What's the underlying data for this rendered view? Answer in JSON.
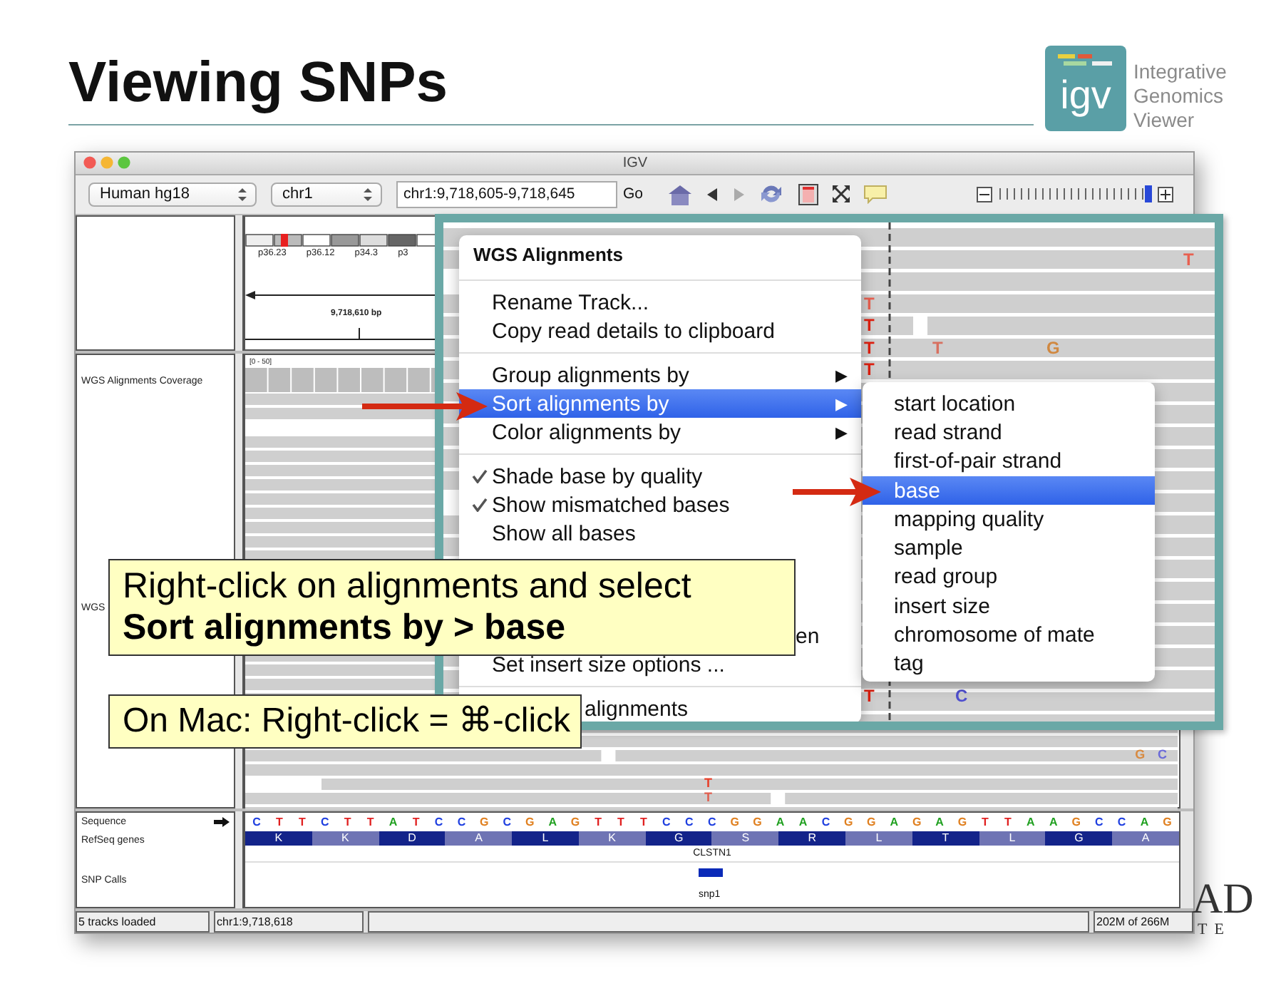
{
  "slide": {
    "title": "Viewing SNPs",
    "logo": {
      "mark": "igv",
      "lines": [
        "Integrative",
        "Genomics",
        "Viewer"
      ]
    },
    "background_logo": [
      "AD",
      "TE"
    ]
  },
  "window": {
    "title": "IGV"
  },
  "toolbar": {
    "genome": "Human hg18",
    "chromosome": "chr1",
    "locus": "chr1:9,718,605-9,718,645",
    "go": "Go",
    "back_disabled": false,
    "forward_disabled": true,
    "zoom": {
      "level": 1
    }
  },
  "ideogram": {
    "bands": [
      "p36.23",
      "p36.12",
      "p34.3",
      "p3"
    ]
  },
  "ruler": {
    "label": "9,718,610 bp"
  },
  "coverage": {
    "name": "WGS Alignments Coverage",
    "range": "[0 - 50]"
  },
  "alignments": {
    "name": "WGS",
    "mismatches": [
      {
        "base": "G",
        "color": "#d88a40"
      },
      {
        "base": "C",
        "color": "#6a6ad8"
      },
      {
        "base": "T",
        "color": "#e8402a"
      },
      {
        "base": "T",
        "color": "#e06050"
      }
    ]
  },
  "sequence": {
    "name": "Sequence",
    "bases": [
      {
        "base": "C",
        "color": "#2040e0"
      },
      {
        "base": "T",
        "color": "#e02020"
      },
      {
        "base": "T",
        "color": "#e02020"
      },
      {
        "base": "C",
        "color": "#2040e0"
      },
      {
        "base": "T",
        "color": "#e02020"
      },
      {
        "base": "T",
        "color": "#e02020"
      },
      {
        "base": "A",
        "color": "#20a020"
      },
      {
        "base": "T",
        "color": "#e02020"
      },
      {
        "base": "C",
        "color": "#2040e0"
      },
      {
        "base": "C",
        "color": "#2040e0"
      },
      {
        "base": "G",
        "color": "#e08020"
      },
      {
        "base": "C",
        "color": "#2040e0"
      },
      {
        "base": "G",
        "color": "#e08020"
      },
      {
        "base": "A",
        "color": "#20a020"
      },
      {
        "base": "G",
        "color": "#e08020"
      },
      {
        "base": "T",
        "color": "#e02020"
      },
      {
        "base": "T",
        "color": "#e02020"
      },
      {
        "base": "T",
        "color": "#e02020"
      },
      {
        "base": "C",
        "color": "#2040e0"
      },
      {
        "base": "C",
        "color": "#2040e0"
      },
      {
        "base": "C",
        "color": "#2040e0"
      },
      {
        "base": "G",
        "color": "#e08020"
      },
      {
        "base": "G",
        "color": "#e08020"
      },
      {
        "base": "A",
        "color": "#20a020"
      },
      {
        "base": "A",
        "color": "#20a020"
      },
      {
        "base": "C",
        "color": "#2040e0"
      },
      {
        "base": "G",
        "color": "#e08020"
      },
      {
        "base": "G",
        "color": "#e08020"
      },
      {
        "base": "A",
        "color": "#20a020"
      },
      {
        "base": "G",
        "color": "#e08020"
      },
      {
        "base": "A",
        "color": "#20a020"
      },
      {
        "base": "G",
        "color": "#e08020"
      },
      {
        "base": "T",
        "color": "#e02020"
      },
      {
        "base": "T",
        "color": "#e02020"
      },
      {
        "base": "A",
        "color": "#20a020"
      },
      {
        "base": "A",
        "color": "#20a020"
      },
      {
        "base": "G",
        "color": "#e08020"
      },
      {
        "base": "C",
        "color": "#2040e0"
      },
      {
        "base": "C",
        "color": "#2040e0"
      },
      {
        "base": "A",
        "color": "#20a020"
      },
      {
        "base": "G",
        "color": "#e08020"
      }
    ]
  },
  "genes": {
    "name": "RefSeq genes",
    "amino_acids": [
      "K",
      "K",
      "D",
      "A",
      "L",
      "K",
      "G",
      "S",
      "R",
      "L",
      "T",
      "L",
      "G",
      "A"
    ],
    "gene": "CLSTN1"
  },
  "snps": {
    "name": "SNP Calls",
    "label": "snp1"
  },
  "status_bar": {
    "left": [
      "5 tracks loaded",
      "chr1:9,718,618"
    ],
    "right": "202M of 266M"
  },
  "inset": {
    "menu": {
      "title": "WGS Alignments",
      "items": [
        {
          "kind": "separator"
        },
        {
          "kind": "item",
          "label": "Rename Track...",
          "selected": false
        },
        {
          "kind": "item",
          "label": "Copy read details to clipboard",
          "selected": false
        },
        {
          "kind": "separator"
        },
        {
          "kind": "submenu",
          "label": "Group alignments by",
          "arrow": "▶",
          "selected": false
        },
        {
          "kind": "submenu",
          "label": "Sort alignments by",
          "arrow": "▶",
          "selected": true
        },
        {
          "kind": "submenu",
          "label": "Color alignments by",
          "arrow": "▶",
          "selected": false
        },
        {
          "kind": "separator"
        },
        {
          "kind": "check",
          "label": "Shade base by quality",
          "checked": true,
          "selected": false
        },
        {
          "kind": "check",
          "label": "Show mismatched bases",
          "checked": true,
          "selected": false
        },
        {
          "kind": "check",
          "label": "Show all bases",
          "checked": false,
          "selected": false
        }
      ],
      "lower_items": [
        {
          "kind": "fragment",
          "label": "en"
        },
        {
          "kind": "item",
          "label": "Set insert size options ...",
          "selected": false
        },
        {
          "kind": "separator"
        },
        {
          "kind": "fragment",
          "label": "alignments"
        }
      ]
    },
    "submenu": [
      {
        "label": "start location",
        "selected": false
      },
      {
        "label": "read strand",
        "selected": false
      },
      {
        "label": "first-of-pair strand",
        "selected": false
      },
      {
        "label": "base",
        "selected": true
      },
      {
        "label": "mapping quality",
        "selected": false
      },
      {
        "label": "sample",
        "selected": false
      },
      {
        "label": "read group",
        "selected": false
      },
      {
        "label": "insert size",
        "selected": false
      },
      {
        "label": "chromosome of mate",
        "selected": false
      },
      {
        "label": "tag",
        "selected": false
      }
    ],
    "mismatches": [
      {
        "base": "T",
        "color": "#e86050"
      },
      {
        "base": "T",
        "color": "#e86050"
      },
      {
        "base": "T",
        "color": "#e02010"
      },
      {
        "base": "T",
        "color": "#e02010"
      },
      {
        "base": "T",
        "color": "#d87060"
      },
      {
        "base": "G",
        "color": "#d08840"
      },
      {
        "base": "T",
        "color": "#e02010"
      },
      {
        "base": "T",
        "color": "#e02010"
      },
      {
        "base": "C",
        "color": "#5050d0"
      }
    ]
  },
  "callouts": [
    {
      "text": "Right-click on alignments and select",
      "emphasis": "Sort alignments by > base"
    },
    {
      "text": "On Mac: Right-click = ⌘-click"
    }
  ]
}
